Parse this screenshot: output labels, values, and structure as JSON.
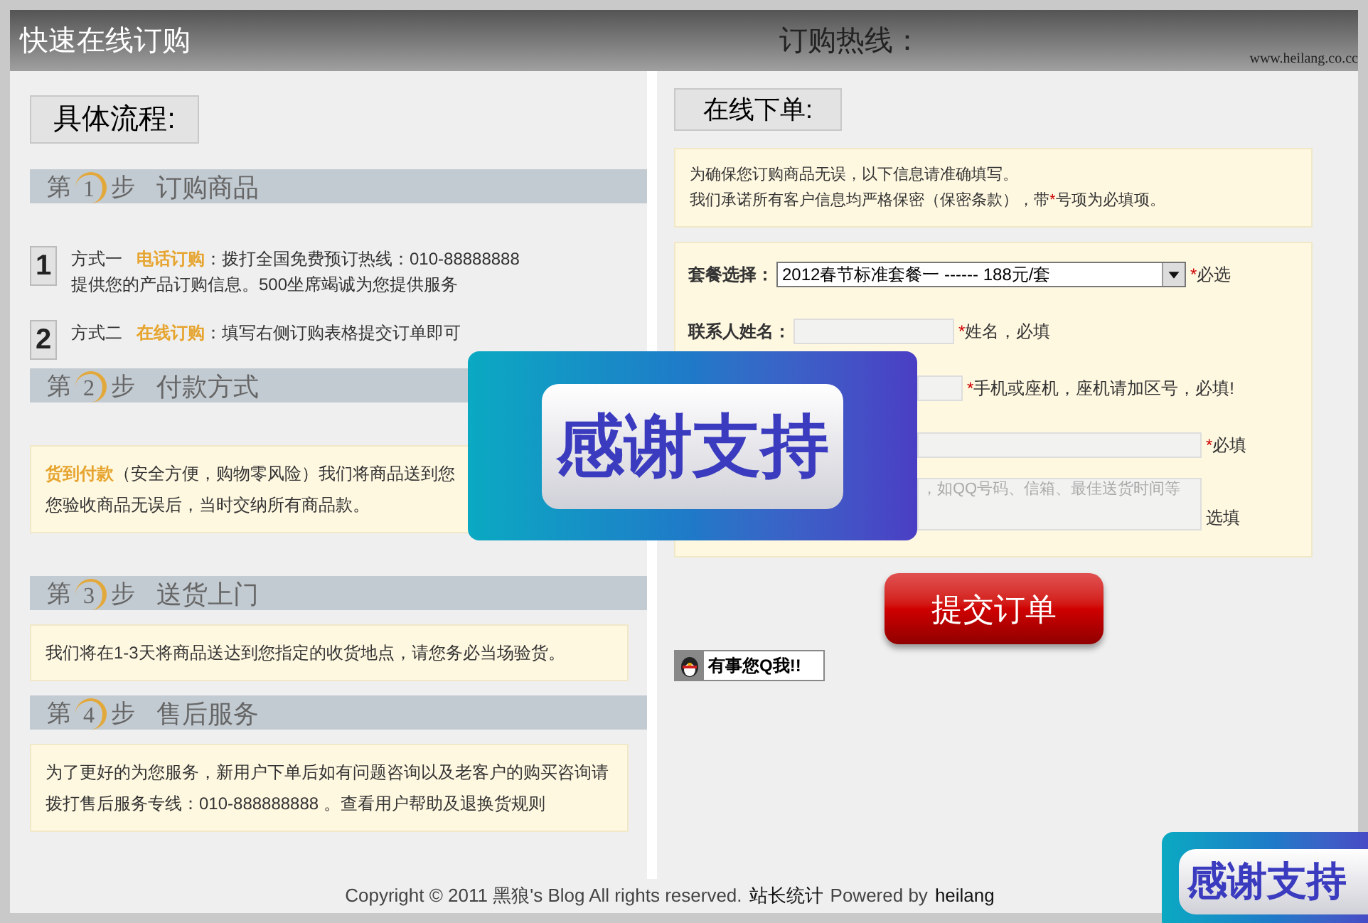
{
  "header": {
    "title": "快速在线订购",
    "hotline": "订购热线：",
    "site": "www.heilang.co.cc"
  },
  "left": {
    "heading": "具体流程:",
    "steps": [
      {
        "prefix": "第",
        "number": "1",
        "suffix": "步",
        "title": "订购商品",
        "kind": "methods",
        "methods": [
          {
            "badge": "1",
            "label": "方式一",
            "highlight": "电话订购",
            "text": "：拨打全国免费预订热线：010-88888888",
            "line2": "提供您的产品订购信息。500坐席竭诚为您提供服务"
          },
          {
            "badge": "2",
            "label": "方式二",
            "highlight": "在线订购",
            "text": "：填写右侧订购表格提交订单即可"
          }
        ]
      },
      {
        "prefix": "第",
        "number": "2",
        "suffix": "步",
        "title": "付款方式",
        "kind": "notice",
        "highlight": "货到付款",
        "text": "（安全方便，购物零风险）我们将商品送到您",
        "line2": "您验收商品无误后，当时交纳所有商品款。"
      },
      {
        "prefix": "第",
        "number": "3",
        "suffix": "步",
        "title": "送货上门",
        "kind": "notice",
        "text": "我们将在1-3天将商品送达到您指定的收货地点，请您务必当场验货。"
      },
      {
        "prefix": "第",
        "number": "4",
        "suffix": "步",
        "title": "售后服务",
        "kind": "notice",
        "text": "为了更好的为您服务，新用户下单后如有问题咨询以及老客户的购买咨询请",
        "line2": "拨打售后服务专线：010-888888888 。查看用户帮助及退换货规则"
      }
    ]
  },
  "right": {
    "heading": "在线下单:",
    "notice": [
      {
        "text": "为确保您订购商品无误，以下信息请准确填写。"
      },
      {
        "text": "我们承诺所有客户信息均严格保密（保密条款），带",
        "mark": "*",
        "after": "号项为必填项。"
      }
    ],
    "fields": [
      {
        "kind": "select",
        "label": "套餐选择：",
        "value": "2012春节标准套餐一 ------ 188元/套",
        "required": true,
        "hint": "必选"
      },
      {
        "kind": "input",
        "label": "联系人姓名：",
        "required": true,
        "hint": "姓名，必填"
      },
      {
        "kind": "input",
        "required": true,
        "hint": "手机或座机，座机请加区号，必填!"
      },
      {
        "kind": "wide",
        "required": true,
        "hint": "必填"
      },
      {
        "kind": "textarea",
        "placeholder": "，如QQ号码、信箱、最佳送货时间等",
        "required": false,
        "hint": "选填"
      }
    ],
    "submit": "提交订单",
    "qq": "有事您Q我!!"
  },
  "footer": {
    "before": "Copyright © 2011 黑狼's Blog All rights reserved.",
    "link": "站长统计",
    "middle": "Powered by",
    "author": "heilang"
  },
  "overlays": [
    {
      "text": "感谢支持"
    },
    {
      "text": "感谢支持"
    }
  ]
}
